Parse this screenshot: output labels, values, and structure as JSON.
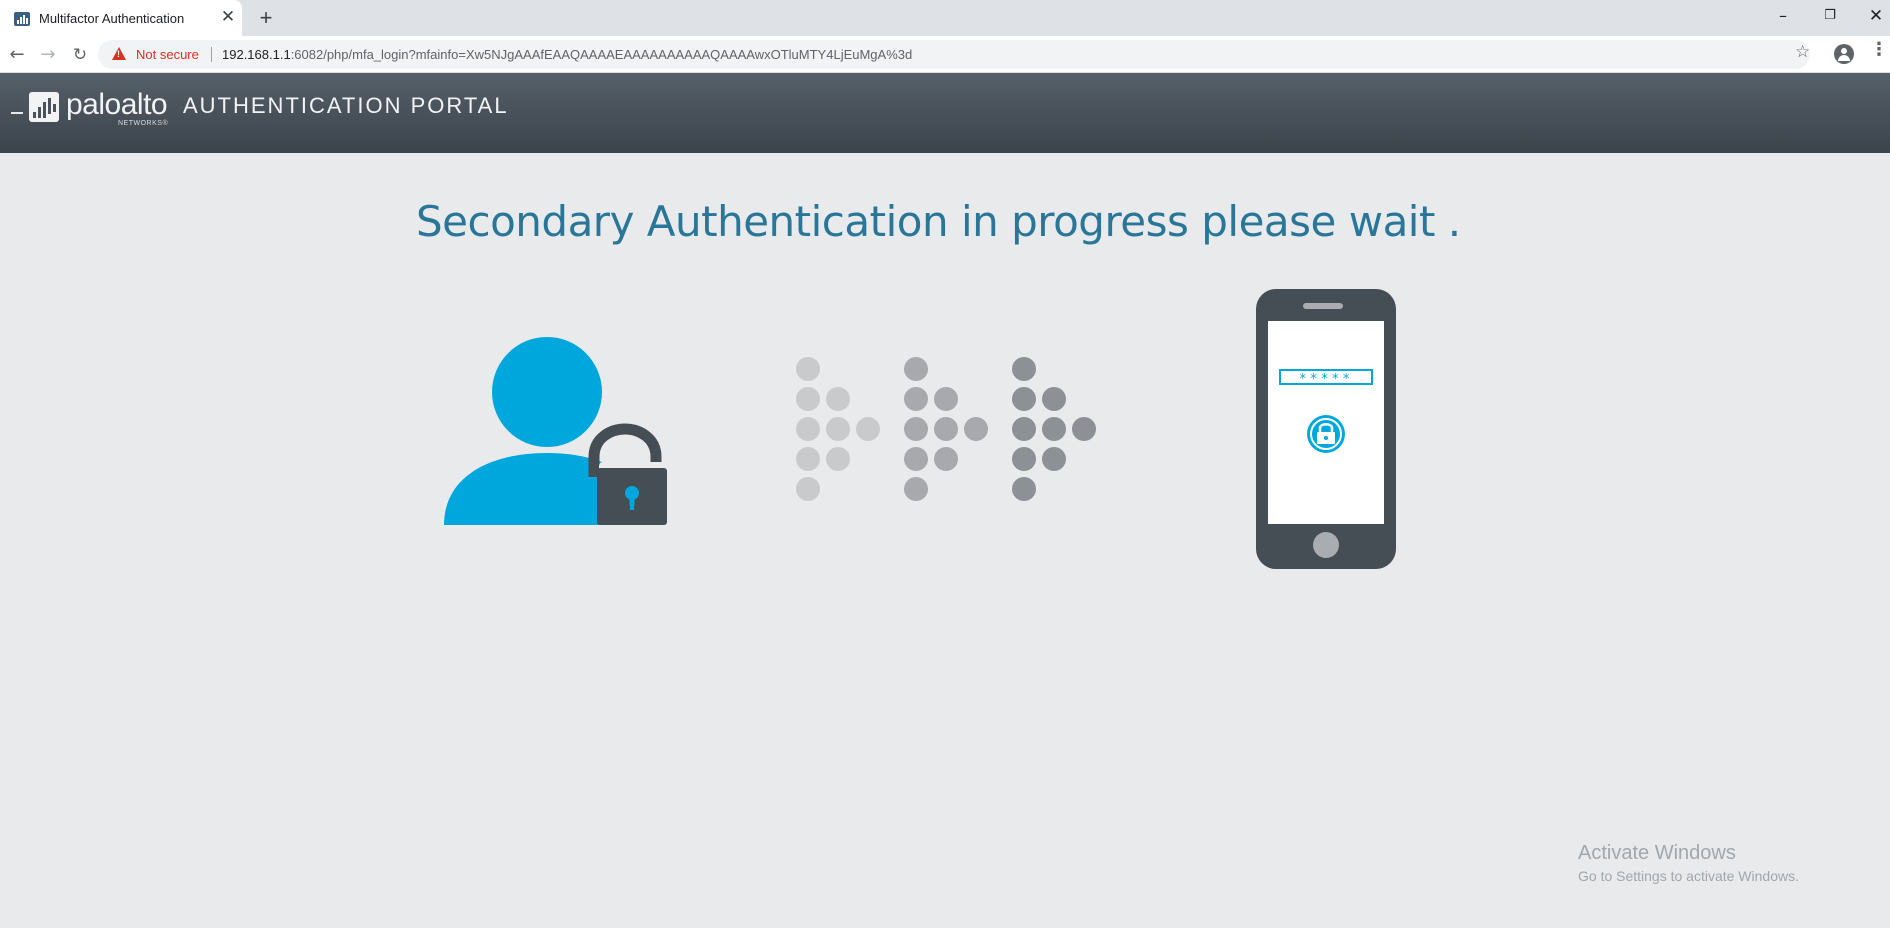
{
  "browser": {
    "tab_title": "Multifactor Authentication",
    "tab_close": "✕",
    "new_tab": "+",
    "window_controls": {
      "minimize": "–",
      "restore": "❐",
      "close": "✕"
    },
    "security_label": "Not secure",
    "url_host": "192.168.1.1",
    "url_rest": ":6082/php/mfa_login?mfainfo=Xw5NJgAAAfEAAQAAAAEAAAAAAAAAAQAAAAwxOTluMTY4LjEuMgA%3d",
    "icons": [
      "back-arrow-icon",
      "forward-arrow-icon",
      "reload-icon",
      "warning-icon",
      "star-icon",
      "profile-icon",
      "menu-icon"
    ]
  },
  "header": {
    "logo_text": "paloalto",
    "logo_subtext": "NETWORKS®",
    "portal_title": "AUTHENTICATION PORTAL"
  },
  "main": {
    "message": "Secondary Authentication in progress please wait .",
    "phone_masked_input": "*****"
  },
  "watermark": {
    "title": "Activate Windows",
    "subtitle": "Go to Settings to activate Windows."
  },
  "colors": {
    "accent_blue": "#00a7dc",
    "message_blue": "#2a7699",
    "dark_gray": "#454d55",
    "header_dark": "#3b434b",
    "page_bg": "#e8eaeb",
    "warning_red": "#d93025"
  }
}
